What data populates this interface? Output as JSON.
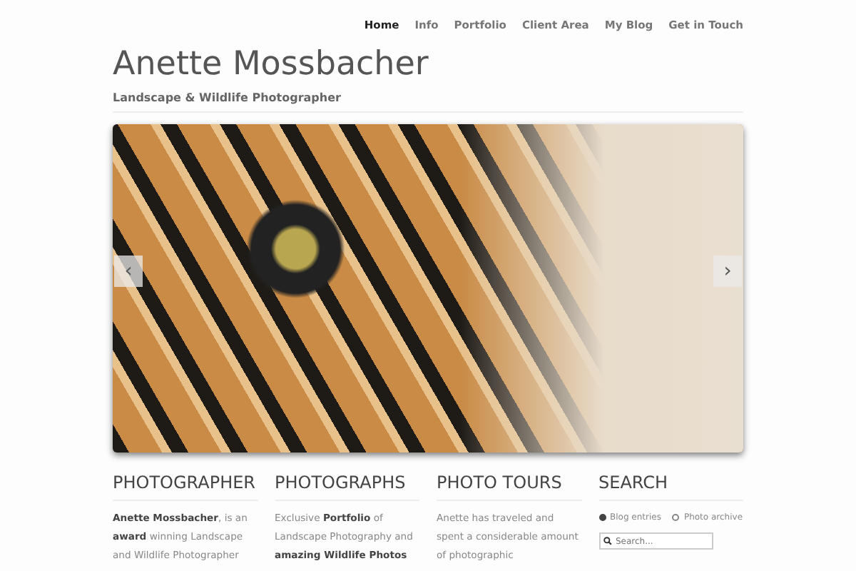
{
  "nav": [
    {
      "label": "Home",
      "selected": true
    },
    {
      "label": "Info",
      "selected": false
    },
    {
      "label": "Portfolio",
      "selected": false
    },
    {
      "label": "Client Area",
      "selected": false
    },
    {
      "label": "My Blog",
      "selected": false
    },
    {
      "label": "Get in Touch",
      "selected": false
    }
  ],
  "site_title": "Anette Mossbacher",
  "tagline": "Landscape & Wildlife Photographer",
  "slider": {
    "prev": "‹",
    "next": "›"
  },
  "columns": [
    {
      "kind": "text",
      "heading": "PHOTOGRAPHER",
      "text": "**Anette Mossbacher**, is an **award** winning Landscape and Wildlife Photographer"
    },
    {
      "kind": "text",
      "heading": "PHOTOGRAPHS",
      "text": "Exclusive **Portfolio** of Landscape Photography and **amazing Wildlife Photos**"
    },
    {
      "kind": "text",
      "heading": "PHOTO TOURS",
      "text": "Anette has traveled and spent a considerable amount of photographic"
    },
    {
      "kind": "search",
      "heading": "SEARCH",
      "options": [
        {
          "label": "Blog entries",
          "selected": true
        },
        {
          "label": "Photo archive",
          "selected": false
        }
      ],
      "placeholder": "Search..."
    }
  ]
}
